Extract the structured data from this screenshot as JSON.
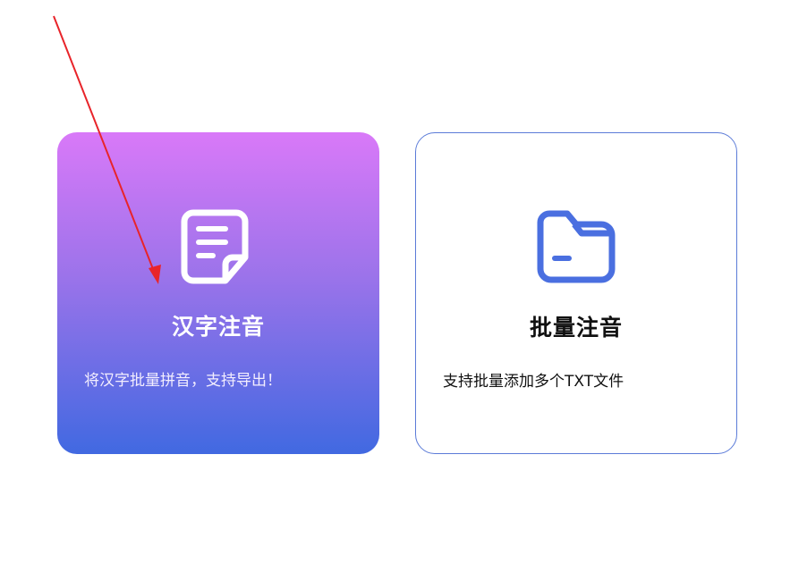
{
  "cards": [
    {
      "title": "汉字注音",
      "description": "将汉字批量拼音，支持导出！",
      "icon": "document-icon",
      "active": true
    },
    {
      "title": "批量注音",
      "description": "支持批量添加多个TXT文件",
      "icon": "folder-icon",
      "active": false
    }
  ],
  "colors": {
    "active_gradient_top": "#d979f8",
    "active_gradient_bottom": "#4169e1",
    "idle_border": "#5b7bd8",
    "folder_icon": "#4a6fe0",
    "annotation_arrow": "#e8242a"
  }
}
